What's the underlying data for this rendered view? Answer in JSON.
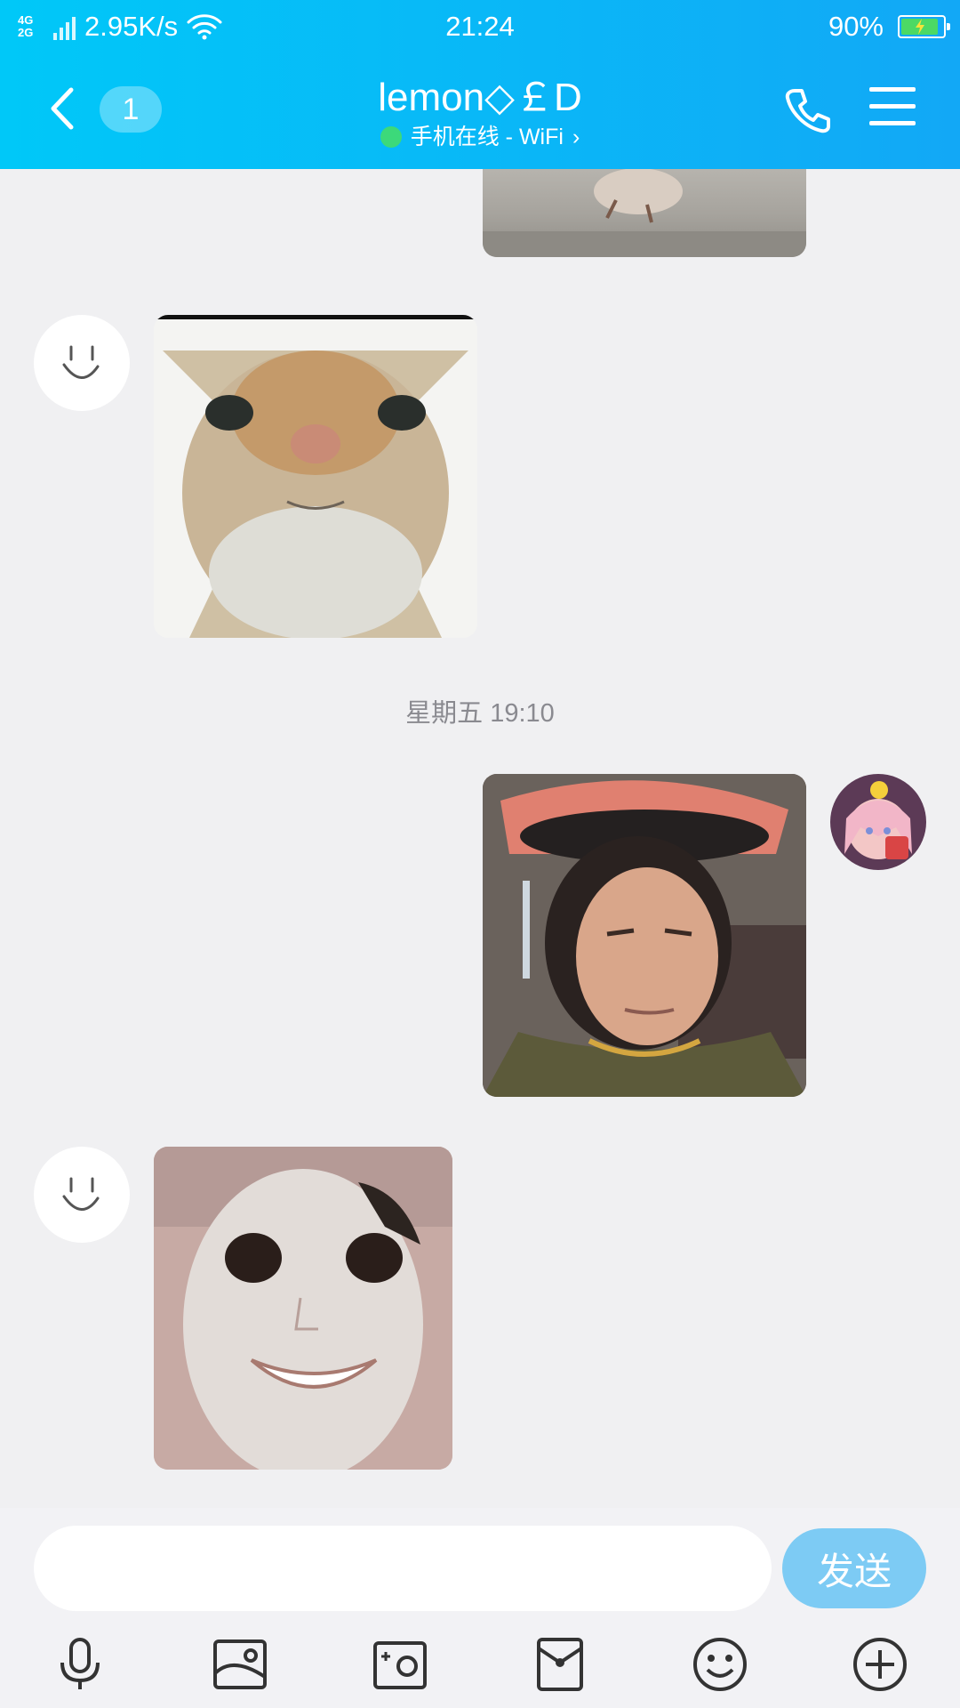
{
  "status_bar": {
    "network_top": "4G",
    "network_bottom": "2G",
    "speed": "2.95K/s",
    "time": "21:24",
    "battery": "90%"
  },
  "header": {
    "unread_count": "1",
    "title": "lemon◇￡D",
    "subtitle": "手机在线 - WiFi",
    "subtitle_chevron": "›"
  },
  "messages": [
    {
      "sender": "me",
      "type": "image",
      "description": "partially visible image at top (cropped)"
    },
    {
      "sender": "contact",
      "type": "image",
      "avatar_icon": "smile-avatar-icon"
    },
    {
      "sender": "me",
      "type": "image",
      "avatar_icon": "anime-avatar"
    },
    {
      "sender": "contact",
      "type": "image",
      "avatar_icon": "smile-avatar-icon"
    }
  ],
  "timestamp": "星期五 19:10",
  "input": {
    "value": "",
    "send_label": "发送"
  },
  "toolbar": {
    "icons": [
      "microphone-icon",
      "image-icon",
      "camera-icon",
      "red-packet-icon",
      "emoji-icon",
      "plus-icon"
    ]
  },
  "colors": {
    "header_gradient_start": "#00c8f8",
    "header_gradient_end": "#12a8f6",
    "chat_background": "#f0f0f2",
    "send_button": "#7dcbf4",
    "online_dot": "#3cd97a",
    "battery_fill": "#4cd964"
  }
}
